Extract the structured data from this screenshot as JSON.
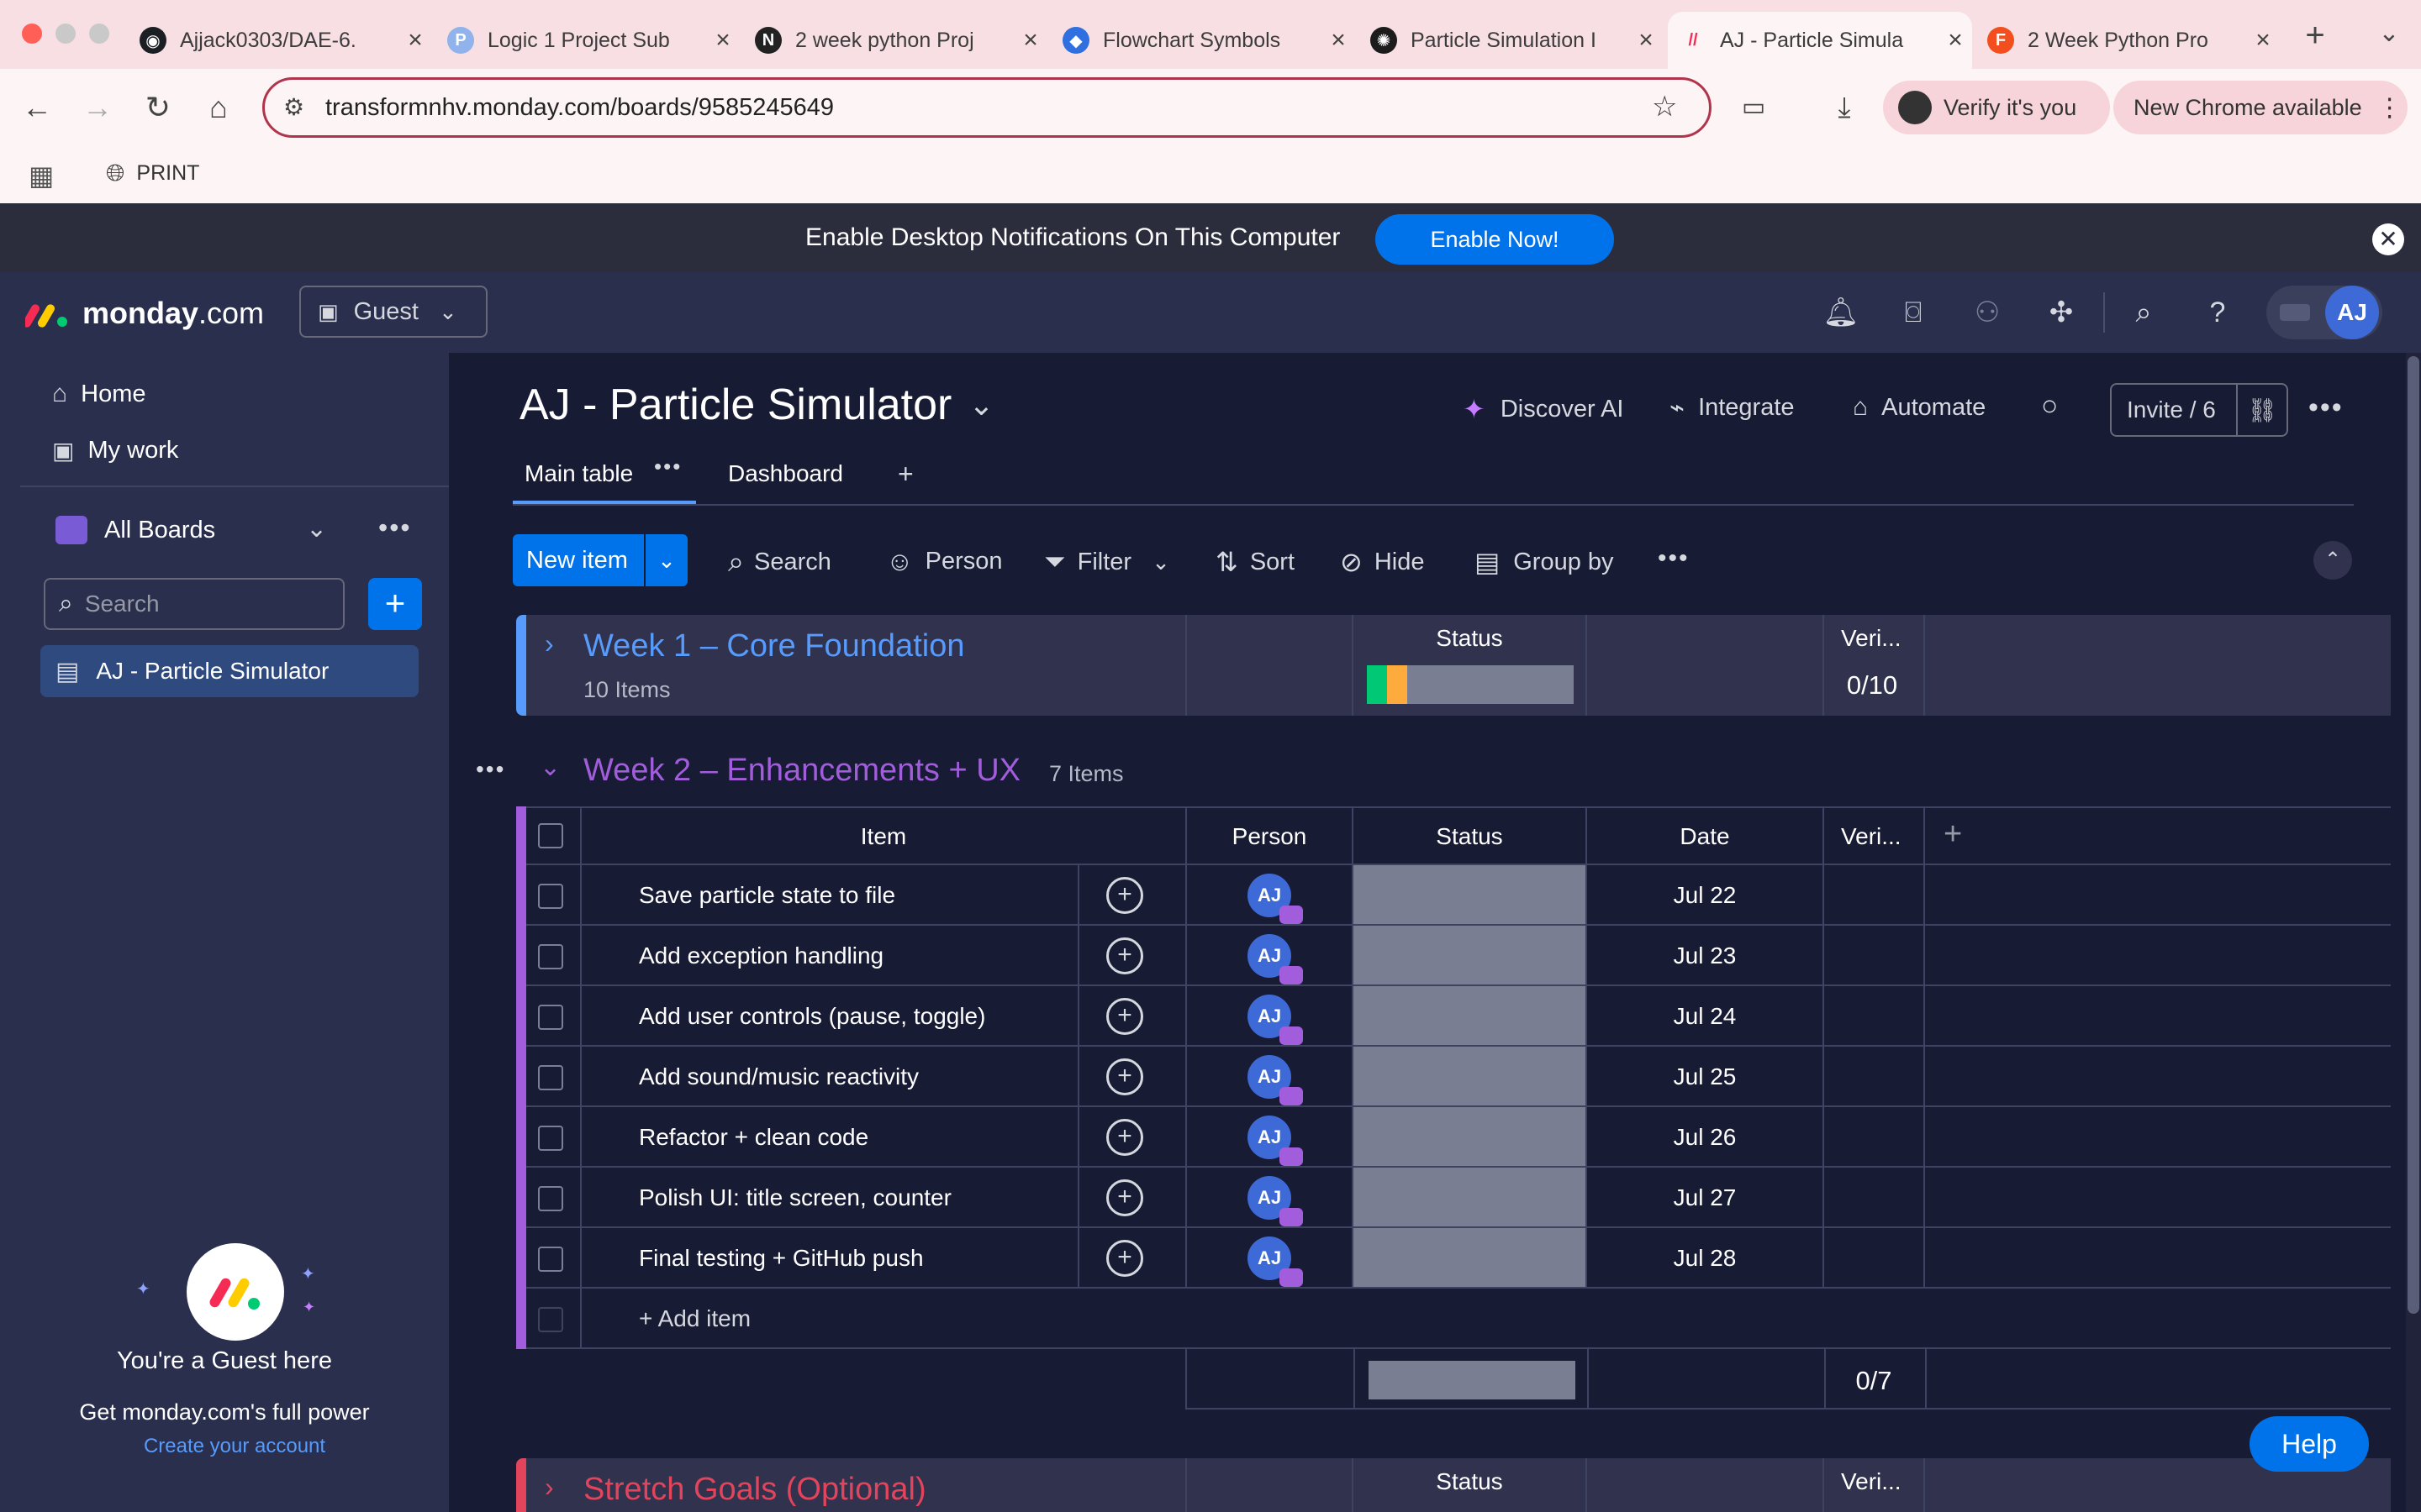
{
  "browser": {
    "tabs": [
      {
        "title": "Ajjack0303/DAE-6.",
        "icon": "github-icon",
        "fav_color": "#1b1f23",
        "fav_glyph": "◉"
      },
      {
        "title": "Logic 1 Project Sub",
        "icon": "paypal-icon",
        "fav_color": "#8fb3ea",
        "fav_glyph": "P"
      },
      {
        "title": "2 week python Proj",
        "icon": "notion-icon",
        "fav_color": "#222222",
        "fav_glyph": "N"
      },
      {
        "title": "Flowchart Symbols",
        "icon": "diamond-icon",
        "fav_color": "#2f6fe0",
        "fav_glyph": "◆"
      },
      {
        "title": "Particle Simulation I",
        "icon": "openai-icon",
        "fav_color": "#1c1c1c",
        "fav_glyph": "✺"
      },
      {
        "title": "AJ - Particle Simula",
        "icon": "monday-icon",
        "fav_color": "#fdf4f5",
        "fav_glyph": "//"
      },
      {
        "title": "2 Week Python Pro",
        "icon": "figma-icon",
        "fav_color": "#f24e1e",
        "fav_glyph": "F"
      }
    ],
    "url": "transformnhv.monday.com/boards/9585245649",
    "verify_label": "Verify it's you",
    "update_label": "New Chrome available",
    "bookmark_label": "PRINT"
  },
  "banner": {
    "text": "Enable Desktop Notifications On This Computer",
    "button": "Enable Now!"
  },
  "header": {
    "logo_text": "monday",
    "logo_suffix": ".com",
    "guest_label": "Guest",
    "avatar": "AJ"
  },
  "sidebar": {
    "home": "Home",
    "my_work": "My work",
    "all_boards": "All Boards",
    "search_placeholder": "Search",
    "board_item": "AJ - Particle Simulator",
    "guest_title": "You're a Guest here",
    "guest_sub": "Get monday.com's full power",
    "guest_link": "Create your account"
  },
  "board": {
    "title": "AJ - Particle Simulator",
    "discover_ai": "Discover AI",
    "integrate": "Integrate",
    "automate": "Automate",
    "invite": "Invite / 6",
    "tabs": {
      "main": "Main table",
      "dashboard": "Dashboard"
    },
    "toolbar": {
      "new_item": "New item",
      "search": "Search",
      "person": "Person",
      "filter": "Filter",
      "sort": "Sort",
      "hide": "Hide",
      "group_by": "Group by"
    }
  },
  "columns": {
    "item": "Item",
    "person": "Person",
    "status": "Status",
    "date": "Date",
    "verified": "Veri..."
  },
  "group1": {
    "title": "Week 1 – Core Foundation",
    "count": "10 Items",
    "verified": "0/10",
    "color": "#579bfc"
  },
  "group2": {
    "title": "Week 2 – Enhancements + UX",
    "count": "7 Items",
    "color": "#a25ddc",
    "verified": "0/7",
    "add_item": "+ Add item",
    "rows": [
      {
        "name": "Save particle state to file",
        "person": "AJ",
        "date": "Jul 22"
      },
      {
        "name": "Add exception handling",
        "person": "AJ",
        "date": "Jul 23"
      },
      {
        "name": "Add user controls (pause, toggle)",
        "person": "AJ",
        "date": "Jul 24"
      },
      {
        "name": "Add sound/music reactivity",
        "person": "AJ",
        "date": "Jul 25"
      },
      {
        "name": "Refactor + clean code",
        "person": "AJ",
        "date": "Jul 26"
      },
      {
        "name": "Polish UI: title screen, counter",
        "person": "AJ",
        "date": "Jul 27"
      },
      {
        "name": "Final testing + GitHub push",
        "person": "AJ",
        "date": "Jul 28"
      }
    ]
  },
  "group3": {
    "title": "Stretch Goals (Optional)",
    "color": "#e2445c"
  },
  "help_label": "Help"
}
